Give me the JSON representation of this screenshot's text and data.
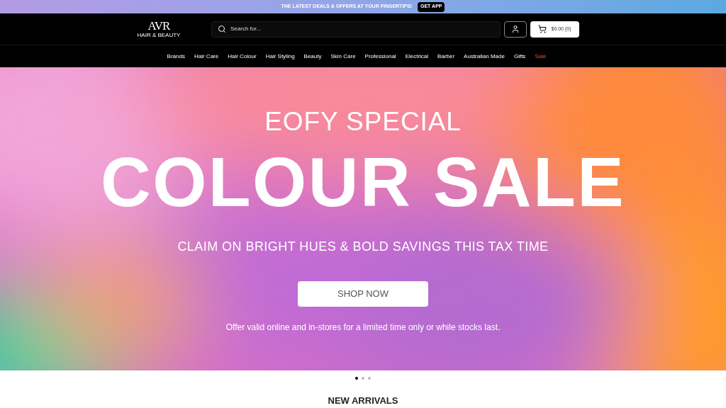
{
  "promo_bar": {
    "text": "THE LATEST DEALS & OFFERS AT YOUR FINGERTIPS!",
    "button": "GET APP"
  },
  "header": {
    "logo": {
      "mark": "AVR",
      "tagline": "HAIR & BEAUTY"
    },
    "search": {
      "placeholder": "Search for..."
    },
    "cart": "$0.00 (0)"
  },
  "nav": [
    {
      "label": "Brands",
      "highlighted": false
    },
    {
      "label": "Hair Care",
      "highlighted": false
    },
    {
      "label": "Hair Colour",
      "highlighted": false
    },
    {
      "label": "Hair Styling",
      "highlighted": false
    },
    {
      "label": "Beauty",
      "highlighted": false
    },
    {
      "label": "Skin Care",
      "highlighted": false
    },
    {
      "label": "Professional",
      "highlighted": false
    },
    {
      "label": "Electrical",
      "highlighted": false
    },
    {
      "label": "Barber",
      "highlighted": false
    },
    {
      "label": "Australian Made",
      "highlighted": false
    },
    {
      "label": "Gifts",
      "highlighted": false
    },
    {
      "label": "Sale",
      "highlighted": true
    }
  ],
  "hero": {
    "eyebrow": "EOFY SPECIAL",
    "title": "COLOUR SALE",
    "subtitle": "CLAIM ON BRIGHT HUES & BOLD SAVINGS THIS TAX TIME",
    "button": "SHOP NOW",
    "note": "Offer valid online and in-stores for a limited time only or while stocks last."
  },
  "slides": [
    {
      "selected": true
    },
    {
      "selected": false
    },
    {
      "selected": false
    }
  ],
  "section_title": "NEW ARRIVALS"
}
